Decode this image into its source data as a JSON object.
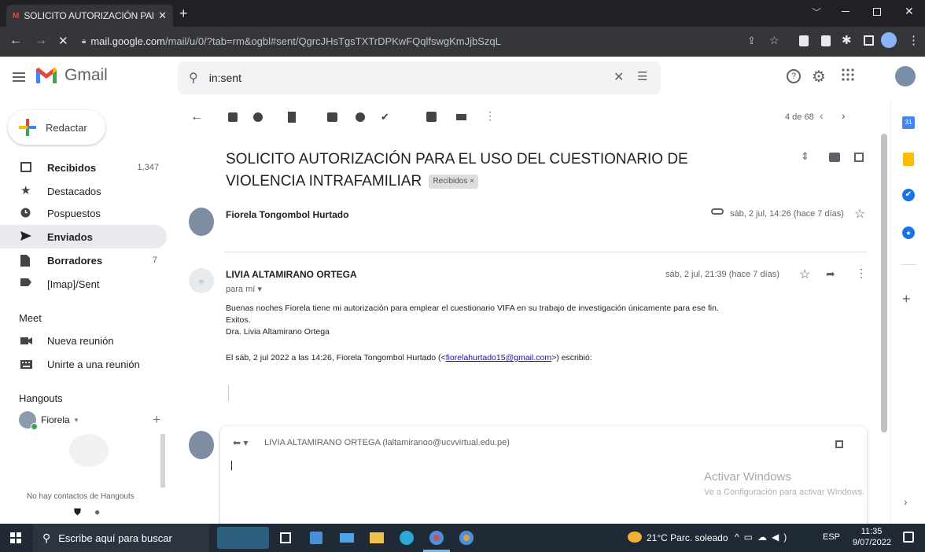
{
  "browser": {
    "tab_title": "SOLICITO AUTORIZACIÓN PARA",
    "url_host": "mail.google.com",
    "url_path": "/mail/u/0/?tab=rm&ogbl#sent/QgrcJHsTgsTXTrDPKwFQqlfswgKmJjbSzqL"
  },
  "gmail": {
    "logo_text": "Gmail",
    "search_value": "in:sent"
  },
  "sidebar": {
    "compose_label": "Redactar",
    "items": [
      {
        "label": "Recibidos",
        "count": "1,347",
        "bold": true,
        "icon": "inbox-icon"
      },
      {
        "label": "Destacados",
        "count": "",
        "bold": false,
        "icon": "star-icon"
      },
      {
        "label": "Pospuestos",
        "count": "",
        "bold": false,
        "icon": "clock-icon"
      },
      {
        "label": "Enviados",
        "count": "",
        "bold": true,
        "icon": "send-icon",
        "selected": true
      },
      {
        "label": "Borradores",
        "count": "7",
        "bold": true,
        "icon": "draft-icon"
      },
      {
        "label": "[Imap]/Sent",
        "count": "",
        "bold": false,
        "icon": "label-icon"
      }
    ],
    "meet_title": "Meet",
    "meet_items": [
      "Nueva reunión",
      "Unirte a una reunión"
    ],
    "hangouts_title": "Hangouts",
    "hangouts_user": "Fiorela",
    "no_contacts": "No hay contactos de Hangouts"
  },
  "toolbar": {
    "pagination": "4 de 68"
  },
  "email": {
    "subject": "SOLICITO AUTORIZACIÓN PARA EL USO DEL CUESTIONARIO DE VIOLENCIA INTRAFAMILIAR",
    "label_badge": "Recibidos ×",
    "msg1": {
      "sender": "Fiorela Tongombol Hurtado",
      "date": "sáb, 2 jul, 14:26 (hace 7 días)"
    },
    "msg2": {
      "sender": "LIVIA ALTAMIRANO ORTEGA",
      "to": "para mí",
      "date": "sáb, 2 jul, 21:39 (hace 7 días)",
      "body_line1": "Buenas noches Fiorela tiene mi autorización para emplear el cuestionario VIFA en su trabajo de investigación únicamente para ese fin.",
      "body_line2": "Exitos.",
      "body_line3": "Dra. Livia Altamirano Ortega",
      "quote_prefix": "El sáb, 2 jul 2022 a las 14:26, Fiorela Tongombol Hurtado (<",
      "quote_email": "fiorelahurtado15@gmail.com",
      "quote_suffix": ">) escribió:"
    },
    "reply_to": "LIVIA ALTAMIRANO ORTEGA (laltamiranoo@ucvvirtual.edu.pe)"
  },
  "watermark": {
    "line1": "Activar Windows",
    "line2": "Ve a Configuración para activar Windows."
  },
  "taskbar": {
    "search_placeholder": "Escribe aquí para buscar",
    "weather": "21°C  Parc. soleado",
    "lang": "ESP",
    "time": "11:35",
    "date": "9/07/2022"
  },
  "colors": {
    "gmail_red": "#ea4335",
    "selected_bg": "#e8eaed",
    "link": "#1a0dab",
    "chrome_dark": "#202124"
  }
}
